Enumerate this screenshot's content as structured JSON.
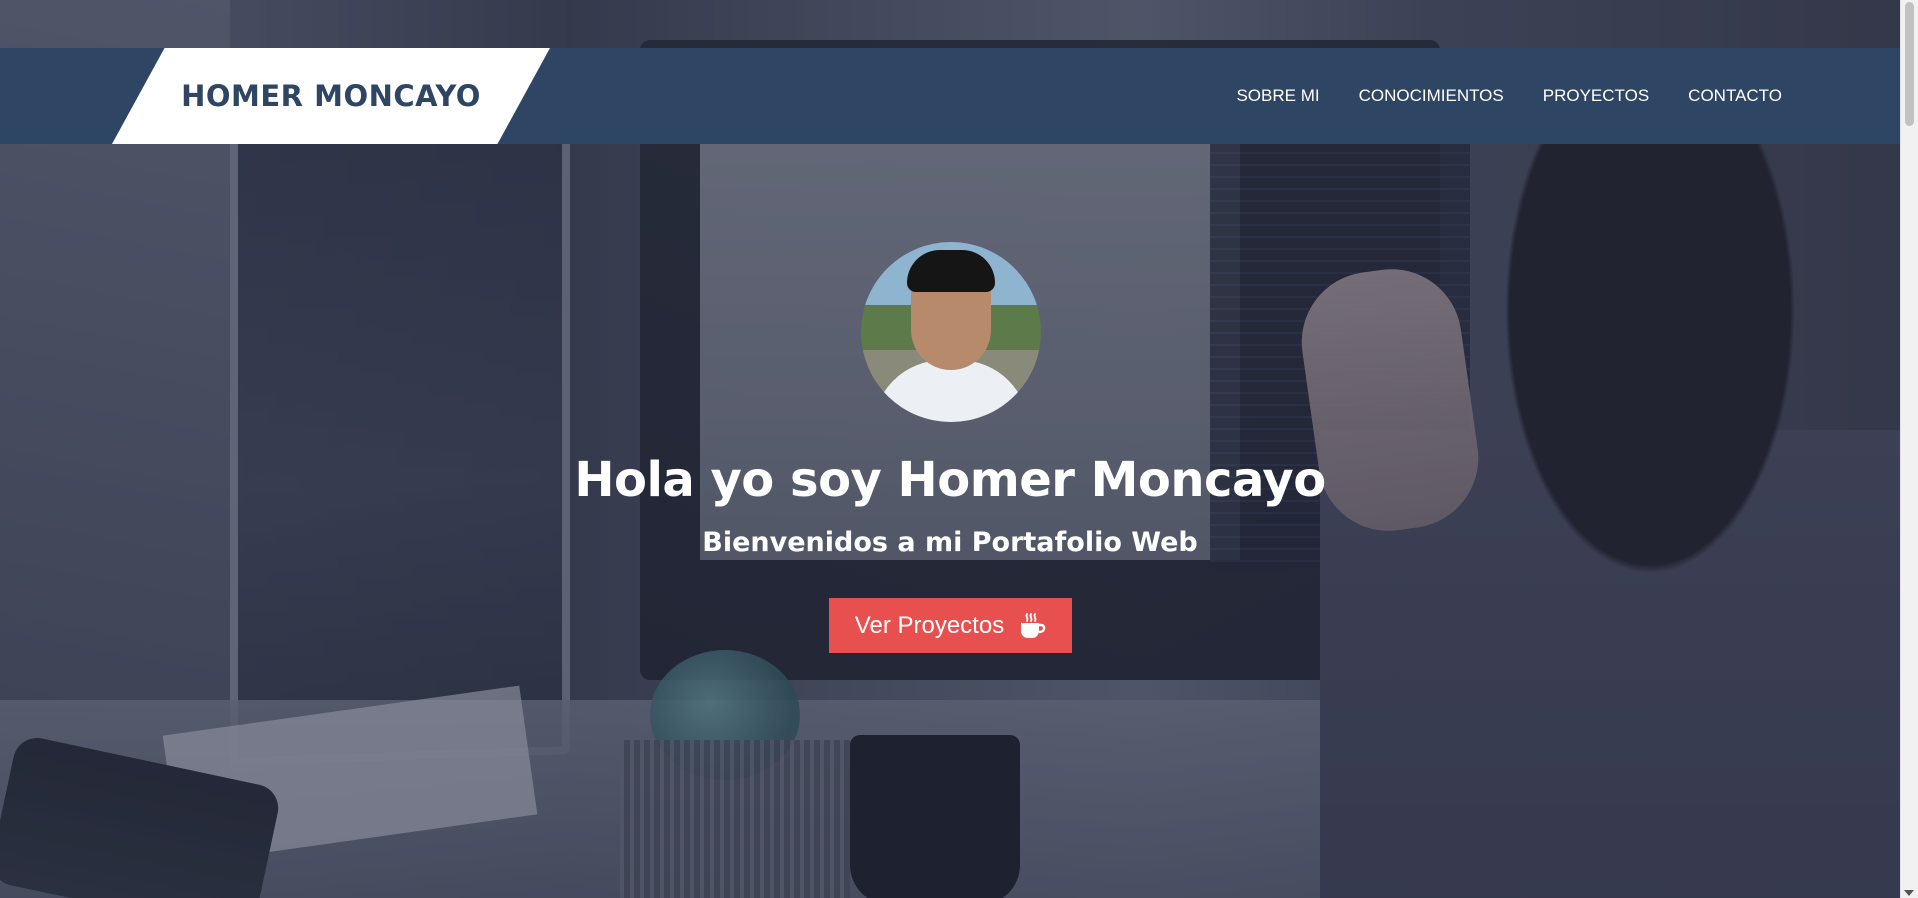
{
  "header": {
    "brand": "HOMER MONCAYO",
    "nav": [
      {
        "label": "SOBRE MI"
      },
      {
        "label": "CONOCIMIENTOS"
      },
      {
        "label": "PROYECTOS"
      },
      {
        "label": "CONTACTO"
      }
    ]
  },
  "hero": {
    "title": "Hola yo soy Homer Moncayo",
    "subtitle": "Bienvenidos a mi Portafolio Web",
    "cta_label": "Ver Proyectos",
    "cta_icon": "coffee-cup-icon",
    "avatar_icon": "profile-photo"
  },
  "colors": {
    "header_bg": "#2e4664",
    "brand_bg": "#ffffff",
    "brand_text": "#2e4664",
    "cta_bg": "#e8504f",
    "text": "#ffffff"
  }
}
